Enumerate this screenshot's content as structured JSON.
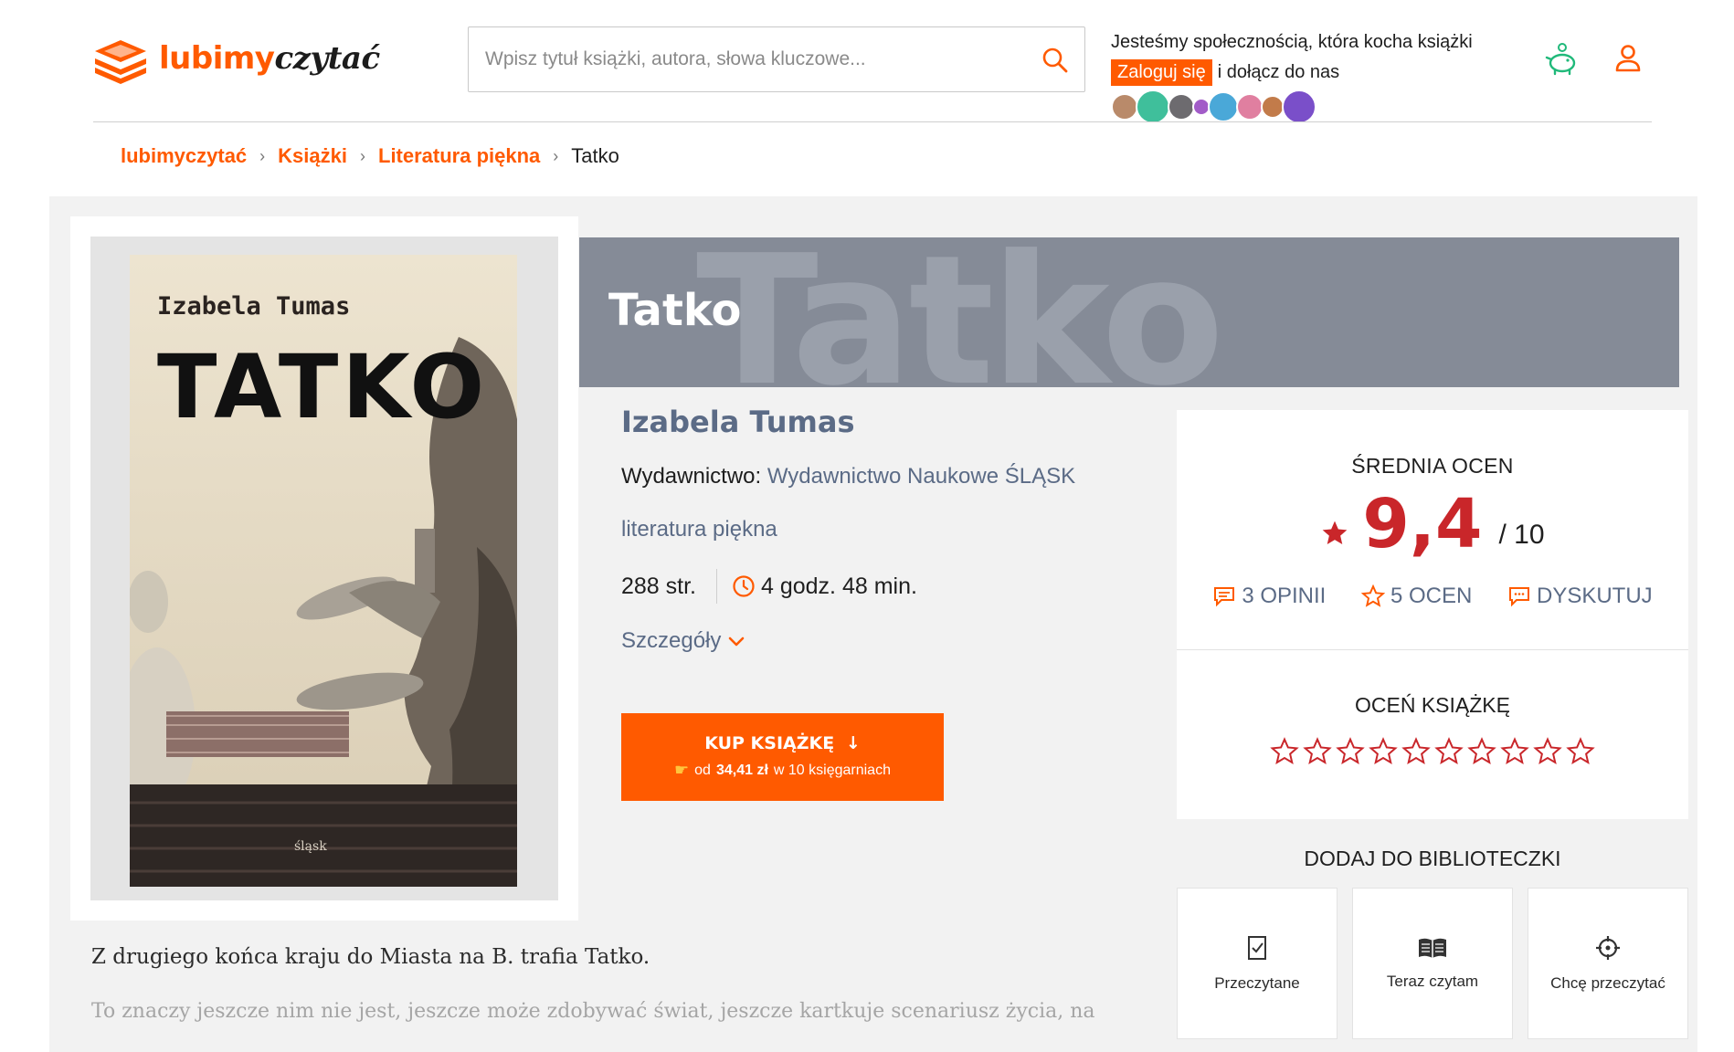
{
  "header": {
    "logo_part1": "lubimy",
    "logo_part2": "czytać",
    "search_placeholder": "Wpisz tytuł książki, autora, słowa kluczowe...",
    "community_text": "Jesteśmy społecznością, która kocha książki",
    "login_label": "Zaloguj się",
    "join_text": "i dołącz do nas",
    "icons": [
      "search-icon",
      "piggy-bank-icon",
      "user-icon"
    ],
    "accent_color": "#ff5a00"
  },
  "breadcrumb": {
    "items": [
      "lubimyczytać",
      "Książki",
      "Literatura piękna"
    ],
    "current": "Tatko"
  },
  "book": {
    "cover_author": "Izabela Tumas",
    "cover_title": "TATKO",
    "cover_publisher": "śląsk",
    "title": "Tatko",
    "title_ghost": "Tatko",
    "author": "Izabela Tumas",
    "publisher_label": "Wydawnictwo:",
    "publisher": "Wydawnictwo Naukowe ŚLĄSK",
    "genre": "literatura piękna",
    "pages": "288 str.",
    "reading_time": "4 godz. 48 min.",
    "details_label": "Szczegóły",
    "buy_label": "KUP KSIĄŻKĘ",
    "buy_price_prefix": "od",
    "buy_price": "34,41 zł",
    "buy_price_suffix": "w 10 księgarniach"
  },
  "rating": {
    "avg_title": "ŚREDNIA OCEN",
    "value": "9,4",
    "max": "/ 10",
    "opinions": "3 OPINII",
    "ratings": "5 OCEN",
    "discuss": "DYSKUTUJ",
    "rate_title": "OCEŃ KSIĄŻKĘ",
    "star_count": 10,
    "star_color": "#c9262a"
  },
  "library": {
    "title": "DODAJ DO BIBLIOTECZKI",
    "buttons": [
      "Przeczytane",
      "Teraz czytam",
      "Chcę przeczytać"
    ]
  },
  "description": {
    "line1": "Z drugiego końca kraju do Miasta na B. trafia Tatko.",
    "line2": "To znaczy jeszcze nim nie jest, jeszcze może zdobywać świat, jeszcze kartkuje scenariusz życia, na"
  }
}
